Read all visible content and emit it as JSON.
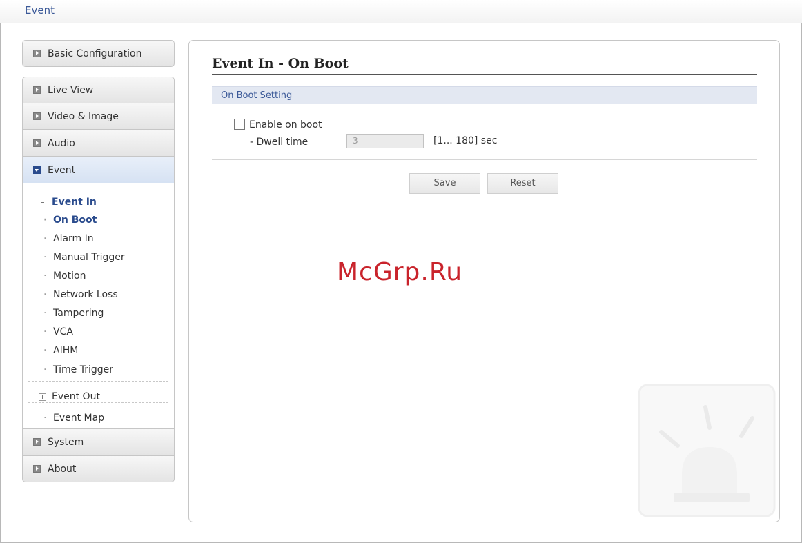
{
  "header": {
    "title": "Event"
  },
  "sidebar": {
    "top_items": [
      {
        "label": "Basic Configuration"
      },
      {
        "label": "Live View"
      },
      {
        "label": "Video & Image"
      },
      {
        "label": "Audio"
      },
      {
        "label": "Event"
      }
    ],
    "event_in": {
      "label": "Event In",
      "items": [
        "On Boot",
        "Alarm In",
        "Manual Trigger",
        "Motion",
        "Network Loss",
        "Tampering",
        "VCA",
        "AIHM",
        "Time Trigger"
      ]
    },
    "event_out": {
      "label": "Event Out"
    },
    "event_map": {
      "label": "Event Map"
    },
    "bottom_items": [
      {
        "label": "System"
      },
      {
        "label": "About"
      }
    ]
  },
  "main": {
    "title": "Event In - On Boot",
    "section": "On Boot Setting",
    "enable_label": "Enable on boot",
    "enable_checked": false,
    "dwell_label": "- Dwell time",
    "dwell_value": "3",
    "dwell_range": "[1... 180] sec",
    "save_label": "Save",
    "reset_label": "Reset"
  },
  "watermark": "McGrp.Ru",
  "colors": {
    "accent": "#3b5998",
    "nav_active": "#2a4b8d",
    "watermark": "#c9232b"
  }
}
